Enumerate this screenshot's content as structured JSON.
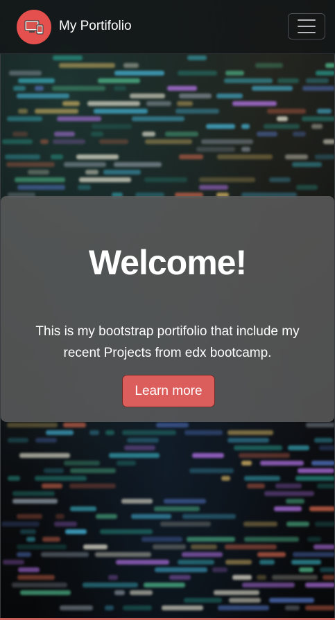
{
  "navbar": {
    "brand_name": "My Portifolio",
    "logo_icon": "devices-icon",
    "toggler_icon": "hamburger-menu-icon"
  },
  "hero": {
    "title": "Welcome!",
    "text": "This is my bootstrap portifolio that include my recent Projects from edx bootcamp.",
    "button_label": "Learn more"
  },
  "colors": {
    "accent": "#e4504d",
    "button": "#dc5e5c",
    "card_bg": "#5f5f5f"
  }
}
